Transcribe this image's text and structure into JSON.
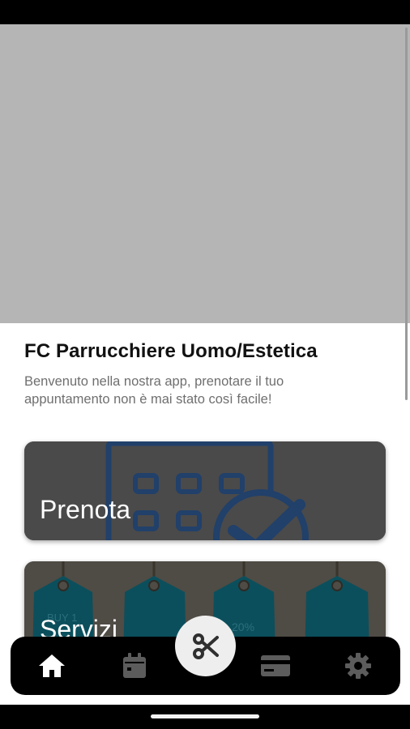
{
  "app": {
    "title": "FC Parrucchiere Uomo/Estetica",
    "welcome_text": "Benvenuto nella nostra app, prenotare il tuo appuntamento non è mai stato così facile!"
  },
  "hero": {
    "placeholder_color": "#b5b5b5"
  },
  "cards": {
    "book": {
      "label": "Prenota",
      "icon": "calendar-check-icon"
    },
    "services": {
      "label": "Servizi",
      "icon": "price-tags-icon",
      "tag_texts": [
        "BUY 1",
        "20%"
      ]
    }
  },
  "bottom_nav": {
    "items": [
      {
        "icon": "home-icon",
        "active": true
      },
      {
        "icon": "calendar-icon",
        "active": false
      },
      {
        "icon": "scissors-icon",
        "active": false
      },
      {
        "icon": "credit-card-icon",
        "active": false
      },
      {
        "icon": "gear-icon",
        "active": false
      }
    ],
    "active_color": "#ffffff",
    "inactive_color": "#5c5c5c"
  }
}
